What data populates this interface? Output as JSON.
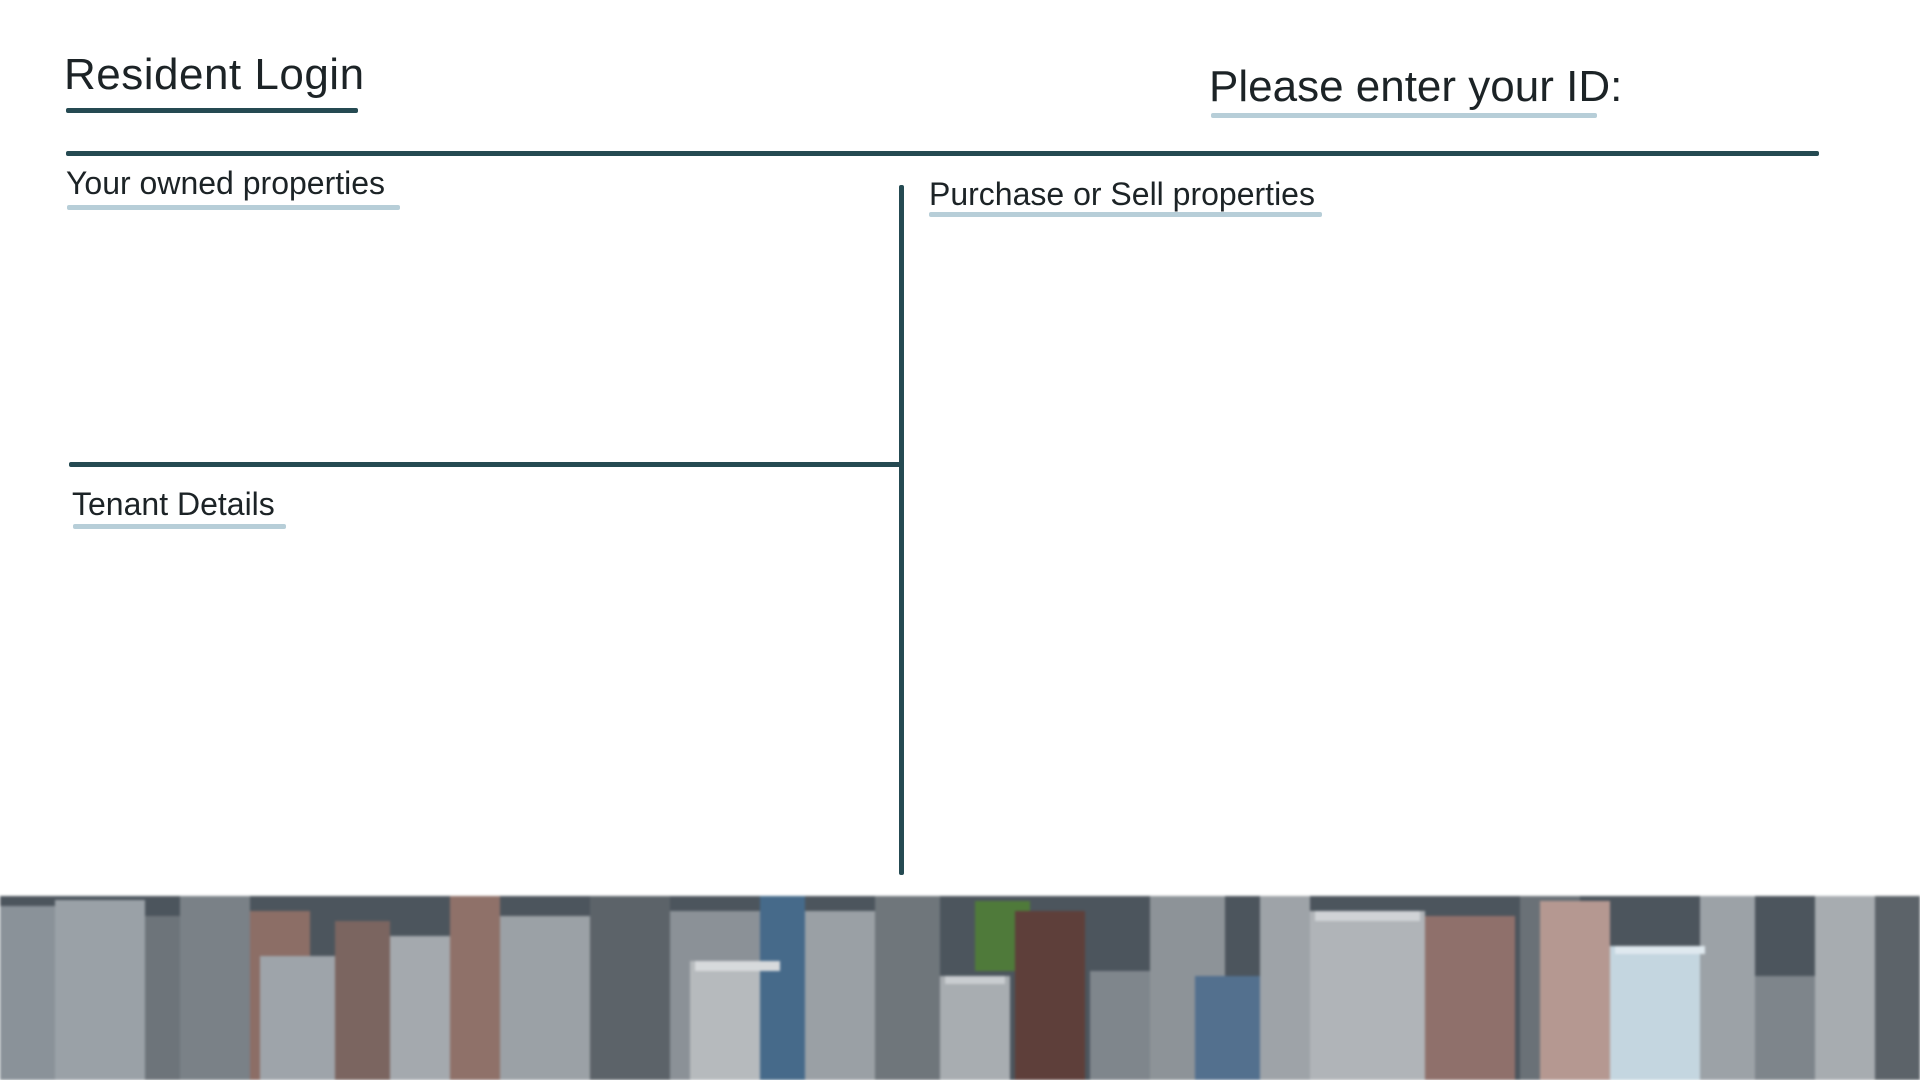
{
  "header": {
    "title": "Resident Login",
    "id_prompt": "Please enter your ID:"
  },
  "sections": {
    "owned": {
      "label": "Your owned properties"
    },
    "tenant": {
      "label": "Tenant Details"
    },
    "trade": {
      "label": "Purchase or Sell properties"
    }
  },
  "banner": {
    "image": "city-skyline"
  },
  "colors": {
    "divider": "#254a52",
    "underline_accent": "#b7ced8",
    "text": "#1c2326",
    "background": "#ffffff"
  }
}
